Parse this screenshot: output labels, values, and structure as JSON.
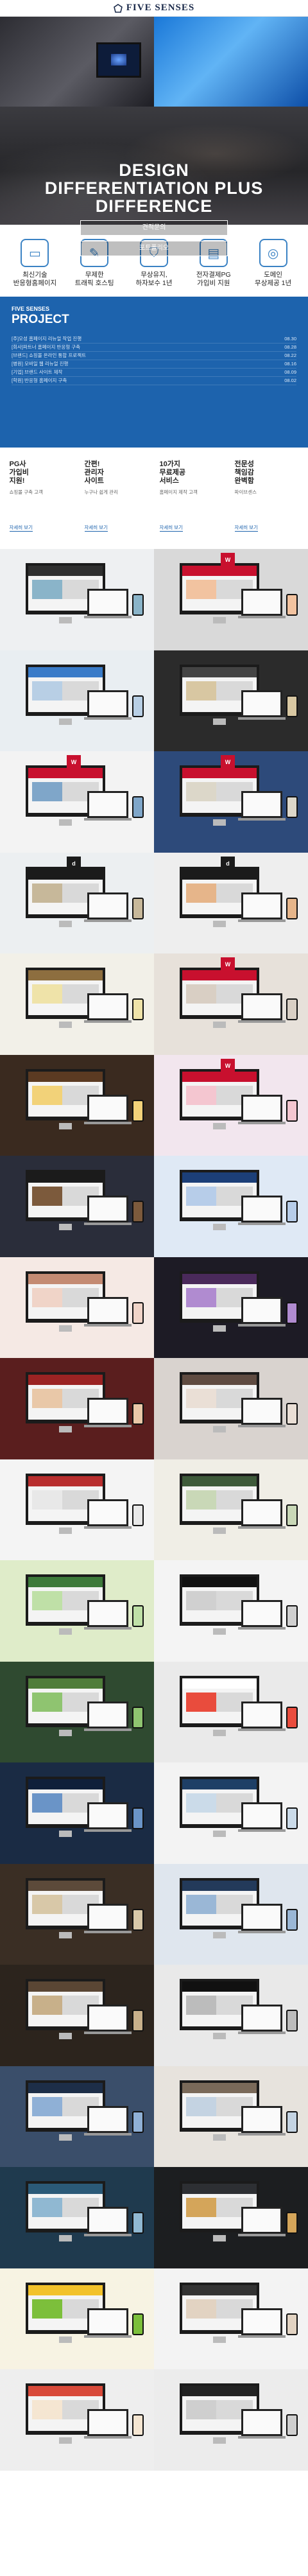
{
  "header": {
    "brand": "FIVE SENSES"
  },
  "hero": {
    "title_lines": [
      "DESIGN",
      "DIFFERENTIATION PLUS",
      "DIFFERENCE"
    ],
    "buttons": [
      "견적문의",
      "포트폴리오"
    ]
  },
  "features": [
    {
      "icon": "monitor-icon",
      "label": "최신기술\n반응형홈페이지"
    },
    {
      "icon": "pen-icon",
      "label": "무제한\n트래픽 호스팅"
    },
    {
      "icon": "shield-icon",
      "label": "무상유지,\n하자보수 1년"
    },
    {
      "icon": "card-icon",
      "label": "전자결제PG\n가입비 지원"
    },
    {
      "icon": "globe-icon",
      "label": "도메인\n무상제공 1년"
    }
  ],
  "project": {
    "label": "FIVE SENSES",
    "title": "PROJECT",
    "items": [
      {
        "text": "[주]오성 홈페이지 리뉴얼 작업 진행",
        "date": "08.30"
      },
      {
        "text": "[회사]파트너 홈페이지 반응형 구축",
        "date": "08.28"
      },
      {
        "text": "[브랜드] 쇼핑몰 온라인 통합 프로젝트",
        "date": "08.22"
      },
      {
        "text": "[병원] 모바일 웹 리뉴얼 진행",
        "date": "08.16"
      },
      {
        "text": "[기업] 브랜드 사이트 제작",
        "date": "08.09"
      },
      {
        "text": "[학원] 반응형 홈페이지 구축",
        "date": "08.02"
      }
    ]
  },
  "info": [
    {
      "title": "PG사\n가입비\n지원!",
      "sub": "쇼핑몰 구축 고객",
      "more": "자세히 보기"
    },
    {
      "title": "간편!\n관리자\n사이트",
      "sub": "누구나 쉽게 관리",
      "more": "자세히 보기"
    },
    {
      "title": "10가지\n무료제공\n서비스",
      "sub": "홈페이지 제작 고객",
      "more": "자세히 보기"
    },
    {
      "title": "전문성\n책임감\n완벽함",
      "sub": "파이브센스",
      "more": "자세히 보기"
    }
  ],
  "portfolio": [
    {
      "bg": "#eef0f2",
      "acc": "#2f2f2f",
      "acc2": "#8ab4c9",
      "badge": ""
    },
    {
      "bg": "#d9d9d9",
      "acc": "#c8102e",
      "acc2": "#f2c3a0",
      "badge": "W"
    },
    {
      "bg": "#e9eef2",
      "acc": "#3a7bc8",
      "acc2": "#b8cfe5",
      "badge": ""
    },
    {
      "bg": "#2b2b2b",
      "acc": "#444444",
      "acc2": "#d8c7a2",
      "badge": ""
    },
    {
      "bg": "#f3f3f3",
      "acc": "#c8102e",
      "acc2": "#7fa6c9",
      "badge": "W"
    },
    {
      "bg": "#2d4a7a",
      "acc": "#c8102e",
      "acc2": "#dcd7c9",
      "badge": "W"
    },
    {
      "bg": "#eceff1",
      "acc": "#1b1b1b",
      "acc2": "#c7b89a",
      "badge": "d"
    },
    {
      "bg": "#eeeeee",
      "acc": "#1b1b1b",
      "acc2": "#e6b58a",
      "badge": "d"
    },
    {
      "bg": "#f2f0e8",
      "acc": "#8d6e3f",
      "acc2": "#efe3a9",
      "badge": ""
    },
    {
      "bg": "#e7e1da",
      "acc": "#c8102e",
      "acc2": "#d9cfc4",
      "badge": "W"
    },
    {
      "bg": "#3a2a1f",
      "acc": "#5b3a22",
      "acc2": "#f2d279",
      "badge": ""
    },
    {
      "bg": "#f2e6ee",
      "acc": "#c8102e",
      "acc2": "#f4c6d0",
      "badge": "W"
    },
    {
      "bg": "#2a2d3a",
      "acc": "#1b1b1b",
      "acc2": "#7c5a3c",
      "badge": ""
    },
    {
      "bg": "#dfe9f5",
      "acc": "#1c3f78",
      "acc2": "#b7cde9",
      "badge": ""
    },
    {
      "bg": "#f5e9e4",
      "acc": "#c48b73",
      "acc2": "#f0d4c8",
      "badge": ""
    },
    {
      "bg": "#1d1b25",
      "acc": "#4a2a5a",
      "acc2": "#b08bd0",
      "badge": ""
    },
    {
      "bg": "#5a1e1e",
      "acc": "#9a2323",
      "acc2": "#e9c8a8",
      "badge": ""
    },
    {
      "bg": "#d9d3cf",
      "acc": "#5f4b41",
      "acc2": "#eadfd6",
      "badge": ""
    },
    {
      "bg": "#f4f4f4",
      "acc": "#b82e2e",
      "acc2": "#e8e8e8",
      "badge": ""
    },
    {
      "bg": "#f0eee6",
      "acc": "#3e5a3a",
      "acc2": "#c9d8b7",
      "badge": ""
    },
    {
      "bg": "#dfecc9",
      "acc": "#3d7a3a",
      "acc2": "#bfe0a7",
      "badge": ""
    },
    {
      "bg": "#f4f4f4",
      "acc": "#111111",
      "acc2": "#d0d0d0",
      "badge": ""
    },
    {
      "bg": "#2f4a30",
      "acc": "#4f7d3a",
      "acc2": "#8fc470",
      "badge": ""
    },
    {
      "bg": "#eaeaea",
      "acc": "#ffffff",
      "acc2": "#e94c3d",
      "badge": ""
    },
    {
      "bg": "#1a2b44",
      "acc": "#0f1f3a",
      "acc2": "#6a94c7",
      "badge": ""
    },
    {
      "bg": "#f3f3f3",
      "acc": "#1e3f66",
      "acc2": "#cbdbe9",
      "badge": ""
    },
    {
      "bg": "#3a2e24",
      "acc": "#5c4a3a",
      "acc2": "#d8c8a8",
      "badge": ""
    },
    {
      "bg": "#dfe6ee",
      "acc": "#233a5a",
      "acc2": "#9ab7d6",
      "badge": ""
    },
    {
      "bg": "#2c241d",
      "acc": "#5a4634",
      "acc2": "#c8b08a",
      "badge": ""
    },
    {
      "bg": "#e9e9e9",
      "acc": "#111111",
      "acc2": "#bcbcbc",
      "badge": ""
    },
    {
      "bg": "#3a4e6a",
      "acc": "#1d2e48",
      "acc2": "#8fb0d6",
      "badge": ""
    },
    {
      "bg": "#e7e3dd",
      "acc": "#7a6a5a",
      "acc2": "#c4d3e2",
      "badge": ""
    },
    {
      "bg": "#1f3a4e",
      "acc": "#2b5a78",
      "acc2": "#90b8d2",
      "badge": ""
    },
    {
      "bg": "#1c1e20",
      "acc": "#2d2f33",
      "acc2": "#d4a55a",
      "badge": ""
    },
    {
      "bg": "#f7f3e3",
      "acc": "#f2c22b",
      "acc2": "#7cbf3b",
      "badge": ""
    },
    {
      "bg": "#f3f3f3",
      "acc": "#333333",
      "acc2": "#e2d3c2",
      "badge": ""
    },
    {
      "bg": "#eeeeee",
      "acc": "#d84a3a",
      "acc2": "#f5e6d2",
      "badge": ""
    },
    {
      "bg": "#ececec",
      "acc": "#222222",
      "acc2": "#cfcfcf",
      "badge": ""
    }
  ]
}
